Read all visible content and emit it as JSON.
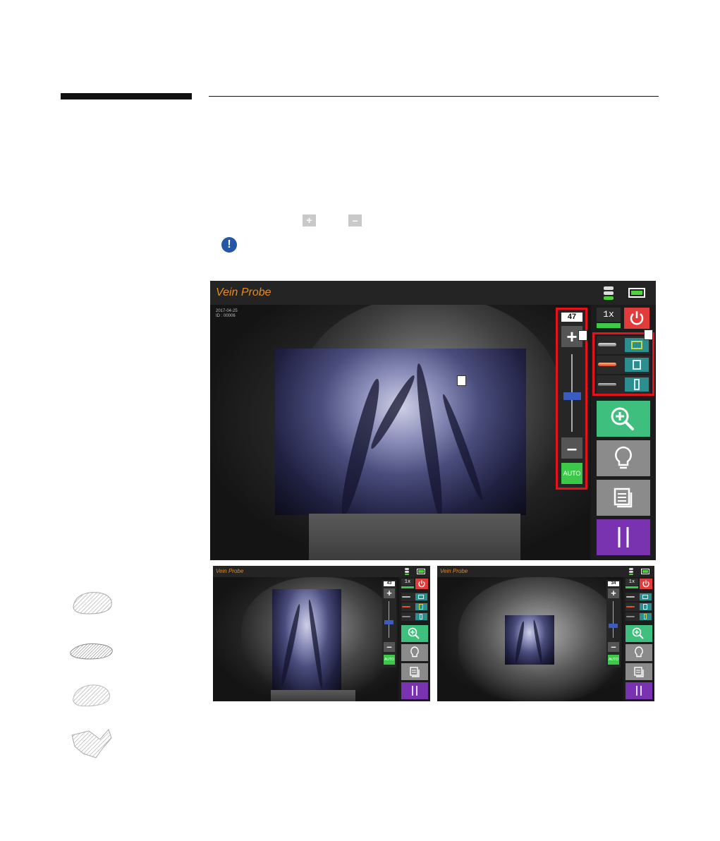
{
  "inline_glyphs": {
    "plus": "+",
    "minus": "–",
    "notice": "!"
  },
  "main_screen": {
    "app_title": "Vein Probe",
    "info_date": "2017-04-25",
    "info_id": "ID : 00006",
    "slider_value": "47",
    "slider_level_fraction": 0.47,
    "zoom_label": "1x",
    "auto_label": "AUTO",
    "plus_label": "+",
    "minus_label": "–"
  },
  "small_screen_left": {
    "app_title": "Vein Probe",
    "slider_value": "43",
    "zoom_label": "1x",
    "auto_label": "AUTO",
    "plus_label": "+",
    "minus_label": "–"
  },
  "small_screen_right": {
    "app_title": "Vein Probe",
    "slider_value": "34",
    "zoom_label": "1x",
    "auto_label": "AUTO",
    "plus_label": "+",
    "minus_label": "–"
  },
  "colors": {
    "title_orange": "#e98a1c",
    "highlight_red": "#e4121d",
    "zoom_green": "#3fbf7e",
    "pause_purple": "#7a33b0",
    "power_red": "#e23b3b",
    "mode_teal": "#2c8f8f"
  },
  "icons": [
    "storage-icon",
    "battery-icon",
    "power-icon",
    "zoom-in-icon",
    "lightbulb-icon",
    "gallery-icon",
    "pause-icon",
    "probe-icon",
    "mode-icon"
  ]
}
